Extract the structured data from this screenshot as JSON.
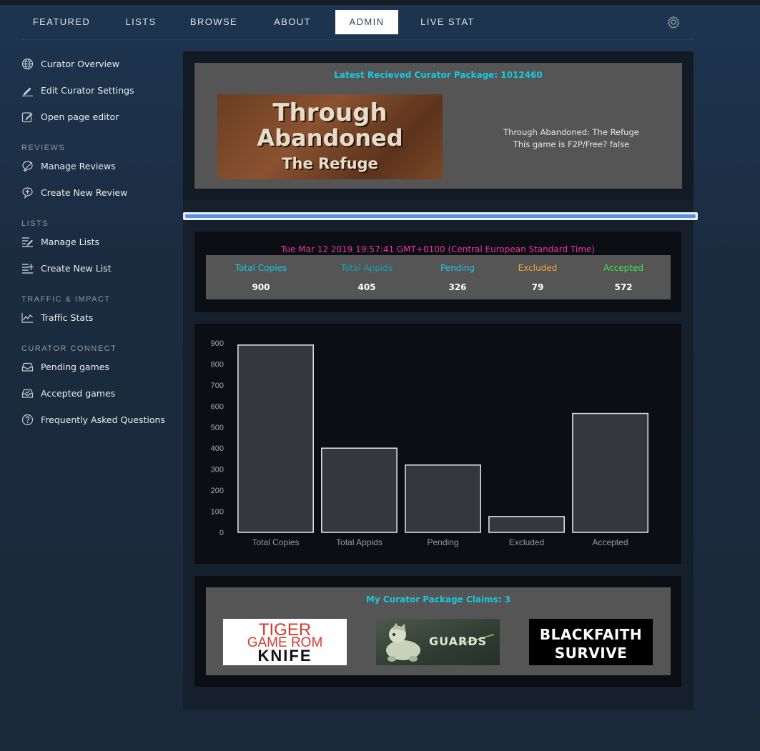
{
  "nav": {
    "items": [
      {
        "label": "FEATURED"
      },
      {
        "label": "LISTS"
      },
      {
        "label": "BROWSE"
      },
      {
        "label": "ABOUT"
      },
      {
        "label": "ADMIN",
        "active": true
      },
      {
        "label": "LIVE STAT"
      }
    ],
    "gear_icon": "gear-icon"
  },
  "sidebar": {
    "items": [
      {
        "label": "Curator Overview",
        "icon": "globe-icon"
      },
      {
        "label": "Edit Curator Settings",
        "icon": "pencil-icon"
      },
      {
        "label": "Open page editor",
        "icon": "edit-page-icon"
      }
    ],
    "sections": [
      {
        "heading": "REVIEWS",
        "items": [
          {
            "label": "Manage Reviews",
            "icon": "manage-reviews-icon"
          },
          {
            "label": "Create New Review",
            "icon": "new-review-icon"
          }
        ]
      },
      {
        "heading": "LISTS",
        "items": [
          {
            "label": "Manage Lists",
            "icon": "manage-lists-icon"
          },
          {
            "label": "Create New List",
            "icon": "new-list-icon"
          }
        ]
      },
      {
        "heading": "TRAFFIC & IMPACT",
        "items": [
          {
            "label": "Traffic Stats",
            "icon": "line-chart-icon"
          }
        ]
      },
      {
        "heading": "CURATOR CONNECT",
        "items": [
          {
            "label": "Pending games",
            "icon": "inbox-icon"
          },
          {
            "label": "Accepted games",
            "icon": "inbox-check-icon"
          },
          {
            "label": "Frequently Asked Questions",
            "icon": "question-icon"
          }
        ]
      }
    ]
  },
  "package": {
    "title": "Latest Recieved Curator Package: 1012460",
    "banner_line1": "Through",
    "banner_line2": "Abandoned",
    "banner_line3": "The Refuge",
    "game_name": "Through Abandoned: The Refuge",
    "f2p_text": "This game is F2P/Free? false"
  },
  "progress": {
    "fraction": 1.0
  },
  "stats": {
    "date": "Tue Mar 12 2019 19:57:41 GMT+0100 (Central European Standard Time)",
    "items": [
      {
        "label": "Total Copies",
        "value": "900",
        "color": "#1ac8db"
      },
      {
        "label": "Total Appids",
        "value": "405",
        "color": "#1a9fb0"
      },
      {
        "label": "Pending",
        "value": "326",
        "color": "#29c3f0"
      },
      {
        "label": "Excluded",
        "value": "79",
        "color": "#f0a43c"
      },
      {
        "label": "Accepted",
        "value": "572",
        "color": "#3ce84a"
      }
    ]
  },
  "chart_data": {
    "type": "bar",
    "categories": [
      "Total Copies",
      "Total Appids",
      "Pending",
      "Excluded",
      "Accepted"
    ],
    "values": [
      890,
      400,
      320,
      75,
      565
    ],
    "ylim": [
      0,
      900
    ],
    "yticks": [
      0,
      100,
      200,
      300,
      400,
      500,
      600,
      700,
      800,
      900
    ],
    "title": "",
    "xlabel": "",
    "ylabel": "",
    "grid": false,
    "bar_fill": "#34373b",
    "bar_stroke": "#e6e6e6"
  },
  "claims": {
    "title": "My Curator Package Claims: 3",
    "games": [
      {
        "line1": "TIGER",
        "line2": "GAME ROM",
        "line3": "KNIFE"
      },
      {
        "line1": "GUARDS"
      },
      {
        "line1": "BLACKFAITH",
        "line2": "SURVIVE"
      }
    ]
  }
}
